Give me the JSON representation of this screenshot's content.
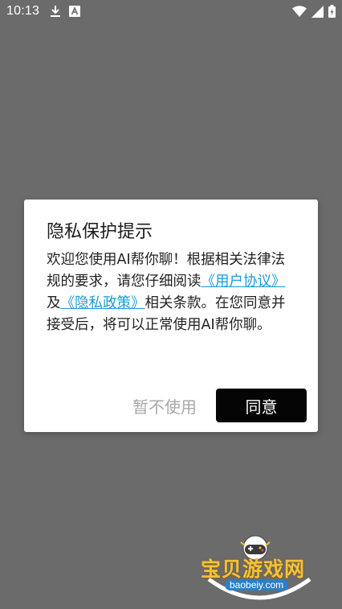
{
  "status_bar": {
    "time": "10:13",
    "icons": [
      "download-icon",
      "a-badge-icon",
      "wifi-icon",
      "signal-icon",
      "battery-icon"
    ]
  },
  "dialog": {
    "title": "隐私保护提示",
    "body_part1": "欢迎您使用AI帮你聊！根据相关法律法规的要求，请您仔细阅读",
    "link_user_agreement": "《用户协议》",
    "body_part2": "及",
    "link_privacy_policy": "《隐私政策》",
    "body_part3": "相关条款。在您同意并接受后，将可以正常使用AI帮你聊。",
    "decline_label": "暂不使用",
    "agree_label": "同意"
  },
  "watermark": {
    "text": "宝贝游戏网",
    "domain": "baobeiy.com"
  },
  "colors": {
    "overlay": "#6b6b6b",
    "link": "#1a9bd7",
    "agree_button": "#050505",
    "decline_text": "#a8a8a8"
  }
}
